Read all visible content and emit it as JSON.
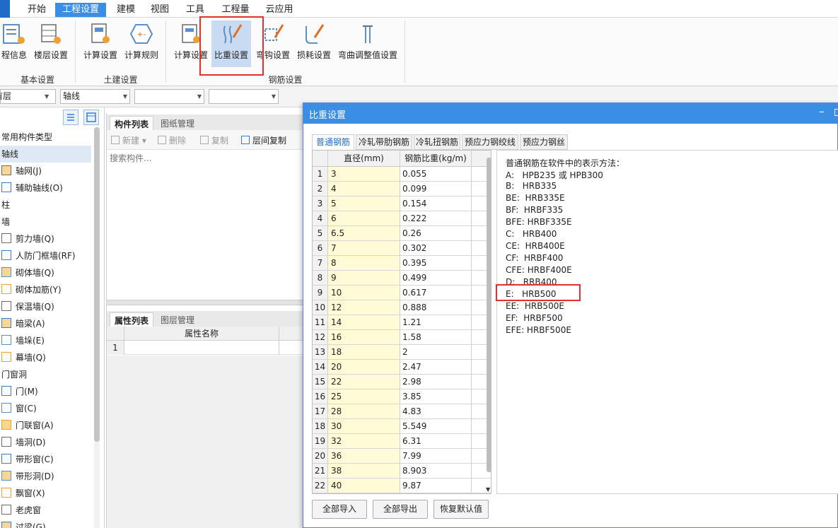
{
  "menu": [
    "开始",
    "工程设置",
    "建模",
    "视图",
    "工具",
    "工程量",
    "云应用"
  ],
  "ribbon": {
    "buttons": [
      "程信息",
      "楼层设置",
      "计算设置",
      "计算规则",
      "计算设置",
      "比重设置",
      "弯钩设置",
      "损耗设置",
      "弯曲调整值设置"
    ],
    "groups": [
      "基本设置",
      "土建设置",
      "钢筋设置"
    ]
  },
  "combos": [
    "首层",
    "轴线",
    "",
    ""
  ],
  "tree": [
    {
      "label": "常用构件类型",
      "type": "category"
    },
    {
      "label": "轴线",
      "type": "category",
      "selected": true
    },
    {
      "label": "轴网(J)",
      "type": "item",
      "icon": "grid-icon"
    },
    {
      "label": "辅助轴线(O)",
      "type": "item",
      "icon": "aux-grid-icon"
    },
    {
      "label": "柱",
      "type": "category"
    },
    {
      "label": "墙",
      "type": "category"
    },
    {
      "label": "剪力墙(Q)",
      "type": "item",
      "icon": "shear-wall-icon"
    },
    {
      "label": "人防门框墙(RF)",
      "type": "item",
      "icon": "door-frame-wall-icon"
    },
    {
      "label": "砌体墙(Q)",
      "type": "item",
      "icon": "masonry-wall-icon"
    },
    {
      "label": "砌体加筋(Y)",
      "type": "item",
      "icon": "masonry-rebar-icon"
    },
    {
      "label": "保温墙(Q)",
      "type": "item",
      "icon": "insulation-wall-icon"
    },
    {
      "label": "暗梁(A)",
      "type": "item",
      "icon": "hidden-beam-icon"
    },
    {
      "label": "墙垛(E)",
      "type": "item",
      "icon": "wall-pier-icon"
    },
    {
      "label": "幕墙(Q)",
      "type": "item",
      "icon": "curtain-wall-icon"
    },
    {
      "label": "门窗洞",
      "type": "category"
    },
    {
      "label": "门(M)",
      "type": "item",
      "icon": "door-icon"
    },
    {
      "label": "窗(C)",
      "type": "item",
      "icon": "window-icon"
    },
    {
      "label": "门联窗(A)",
      "type": "item",
      "icon": "door-window-icon"
    },
    {
      "label": "墙洞(D)",
      "type": "item",
      "icon": "wall-hole-icon"
    },
    {
      "label": "带形窗(C)",
      "type": "item",
      "icon": "strip-window-icon"
    },
    {
      "label": "带形洞(D)",
      "type": "item",
      "icon": "strip-hole-icon"
    },
    {
      "label": "飘窗(X)",
      "type": "item",
      "icon": "bay-window-icon"
    },
    {
      "label": "老虎窗",
      "type": "item",
      "icon": "dormer-window-icon"
    },
    {
      "label": "过梁(G)",
      "type": "item",
      "icon": "lintel-icon"
    }
  ],
  "middle": {
    "tabs_top": [
      "构件列表",
      "图纸管理"
    ],
    "tools": [
      "新建",
      "删除",
      "复制",
      "层间复制"
    ],
    "search_placeholder": "搜索构件...",
    "tabs_bottom": [
      "属性列表",
      "图层管理"
    ],
    "prop_header": "属性名称",
    "prop_row_num": "1"
  },
  "dialog": {
    "title": "比重设置",
    "tabs": [
      "普通钢筋",
      "冷轧带肋钢筋",
      "冷轧扭钢筋",
      "预应力钢绞线",
      "预应力钢丝"
    ],
    "col_diameter": "直径(mm)",
    "col_weight": "钢筋比重(kg/m)",
    "rows": [
      [
        "1",
        "3",
        "0.055"
      ],
      [
        "2",
        "4",
        "0.099"
      ],
      [
        "3",
        "5",
        "0.154"
      ],
      [
        "4",
        "6",
        "0.222"
      ],
      [
        "5",
        "6.5",
        "0.26"
      ],
      [
        "6",
        "7",
        "0.302"
      ],
      [
        "7",
        "8",
        "0.395"
      ],
      [
        "8",
        "9",
        "0.499"
      ],
      [
        "9",
        "10",
        "0.617"
      ],
      [
        "10",
        "12",
        "0.888"
      ],
      [
        "11",
        "14",
        "1.21"
      ],
      [
        "12",
        "16",
        "1.58"
      ],
      [
        "13",
        "18",
        "2"
      ],
      [
        "14",
        "20",
        "2.47"
      ],
      [
        "15",
        "22",
        "2.98"
      ],
      [
        "16",
        "25",
        "3.85"
      ],
      [
        "17",
        "28",
        "4.83"
      ],
      [
        "18",
        "30",
        "5.549"
      ],
      [
        "19",
        "32",
        "6.31"
      ],
      [
        "20",
        "36",
        "7.99"
      ],
      [
        "21",
        "38",
        "8.903"
      ],
      [
        "22",
        "40",
        "9.87"
      ]
    ],
    "info_lines": [
      "普通钢筋在软件中的表示方法：",
      "A:   HPB235 或 HPB300",
      "B:   HRB335",
      "BE:  HRB335E",
      "BF:  HRBF335",
      "BFE: HRBF335E",
      "C:   HRB400",
      "CE:  HRB400E",
      "CF:  HRBF400",
      "CFE: HRBF400E",
      "D:   RRB400",
      "E:   HRB500",
      "EE:  HRB500E",
      "EF:  HRBF500",
      "EFE: HRBF500E"
    ],
    "buttons": [
      "全部导入",
      "全部导出",
      "恢复默认值"
    ]
  },
  "colors": {
    "accent": "#3a8ee6",
    "highlight": "#e03030",
    "diameter_cell": "#fffbd6"
  }
}
